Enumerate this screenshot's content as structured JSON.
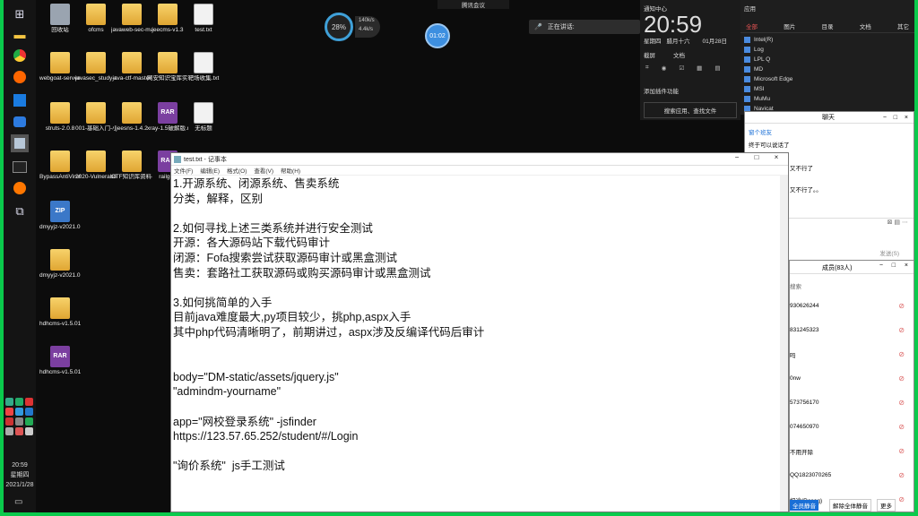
{
  "desktop": {
    "icons": [
      {
        "label": "回收站",
        "type": "recycle",
        "icon": "recycle-bin-icon"
      },
      {
        "label": "ofcms",
        "type": "folder",
        "icon": "folder-icon"
      },
      {
        "label": "javaweb-sec-master",
        "type": "folder",
        "icon": "folder-icon"
      },
      {
        "label": "jeecms-v1.3",
        "type": "folder",
        "icon": "folder-icon"
      },
      {
        "label": "test.txt",
        "type": "file",
        "icon": "text-file-icon"
      },
      {
        "label": "webgoat-server-8.1.0",
        "type": "folder",
        "icon": "folder-icon"
      },
      {
        "label": "javasec_study-master",
        "type": "folder",
        "icon": "folder-icon"
      },
      {
        "label": "java-ctf-master",
        "type": "folder",
        "icon": "folder-icon"
      },
      {
        "label": "网安知识宝库实战演练...",
        "type": "folder",
        "icon": "folder-icon"
      },
      {
        "label": "靶场收集.txt",
        "type": "file",
        "icon": "text-file-icon"
      },
      {
        "label": "struts-2.0.8",
        "type": "folder",
        "icon": "folder-icon"
      },
      {
        "label": "001-基础入门-小迪安全",
        "type": "folder",
        "icon": "folder-icon"
      },
      {
        "label": "jeesns-1.4.2",
        "type": "folder",
        "icon": "folder-icon"
      },
      {
        "label": "xray-1.5破解版.rar",
        "type": "rar",
        "icon": "rar-archive-icon"
      },
      {
        "label": "无标题",
        "type": "file",
        "icon": "text-file-icon"
      },
      {
        "label": "BypassAntiVirus",
        "type": "folder",
        "icon": "folder-icon"
      },
      {
        "label": "2020-Vulnerabilities-m...",
        "type": "folder",
        "icon": "folder-icon"
      },
      {
        "label": "CTF知识库资料-小迪...",
        "type": "folder",
        "icon": "folder-icon"
      },
      {
        "label": "railgun",
        "type": "rar",
        "icon": "rar-archive-icon"
      },
      {
        "label": "dmyyjz-v2021.0125.zip",
        "type": "zip",
        "icon": "zip-archive-icon"
      },
      {
        "label": "dmyyjz-v2021.0125",
        "type": "folder",
        "icon": "folder-icon"
      },
      {
        "label": "hdhcms-v1.5.0120",
        "type": "folder",
        "icon": "folder-icon"
      },
      {
        "label": "hdhcms-v1.5.0120.rar",
        "type": "rar",
        "icon": "rar-archive-icon"
      }
    ]
  },
  "overlay": {
    "mem_percent": "28%",
    "net_up": "140k/s",
    "net_down": "4.4k/s",
    "recording_time": "01:02",
    "meeting_label": "腾讯会议",
    "share_label": "正在讲话:"
  },
  "taskbar": {
    "time": "20:59",
    "weekday": "星期四",
    "date": "2021/1/28"
  },
  "action_center": {
    "title": "通知中心",
    "time": "20:59",
    "weekday": "星期四",
    "lunar": "腊月十六",
    "date": "01月28日",
    "quick1": "截屏",
    "quick2": "文档",
    "add_widget": "添加插件功能",
    "search_placeholder": "搜索应用、查找文件"
  },
  "start_menu": {
    "header": "应用",
    "tabs": [
      "全部",
      "图片",
      "目录",
      "文档",
      "其它"
    ],
    "items": [
      "Intel(R)",
      "Log",
      "LPL Q",
      "MD",
      "Microsoft Edge",
      "MSI",
      "MuMu",
      "Navicat"
    ]
  },
  "notepad": {
    "title": "test.txt - 记事本",
    "menu": [
      "文件(F)",
      "编辑(E)",
      "格式(O)",
      "查看(V)",
      "帮助(H)"
    ],
    "content": "1.开源系统、闭源系统、售卖系统\n分类，解释，区别\n\n2.如何寻找上述三类系统并进行安全测试\n开源：各大源码站下载代码审计\n闭源：Fofa搜索尝试获取源码审计或黑盒测试\n售卖：套路社工获取源码或购买源码审计或黑盒测试\n\n3.如何挑简单的入手\n目前java难度最大,py项目较少，挑php,aspx入手\n其中php代码清晰明了，前期讲过，aspx涉及反编译代码后审计\n\n\nbody=\"DM-static/assets/jquery.js\"\n\"admindm-yourname\"\n\napp=\"网校登录系统\" -jsfinder\nhttps://123.57.65.252/student/#/Login\n\n\"询价系统\"  js手工测试"
  },
  "chat1": {
    "title": "聊天",
    "link": "窗个班友",
    "msg0": "终于可以说话了",
    "msg1": "又不行了",
    "msg2": "又不行了。。",
    "send_label": "发送(S)"
  },
  "chat2": {
    "title": "成员(83人)",
    "search": "搜索",
    "members": [
      "930626244",
      "831245323",
      "吗",
      "0nw",
      "573756170",
      "074650970",
      "不用开除",
      "QQ1823070265",
      "坦途(Rosag)"
    ],
    "btn_left": "全员静音",
    "btn_mid": "解除全体静音",
    "btn_right": "更多"
  },
  "colors": {
    "green_border": "#0aca4c",
    "accent": "#3d8fe0"
  }
}
